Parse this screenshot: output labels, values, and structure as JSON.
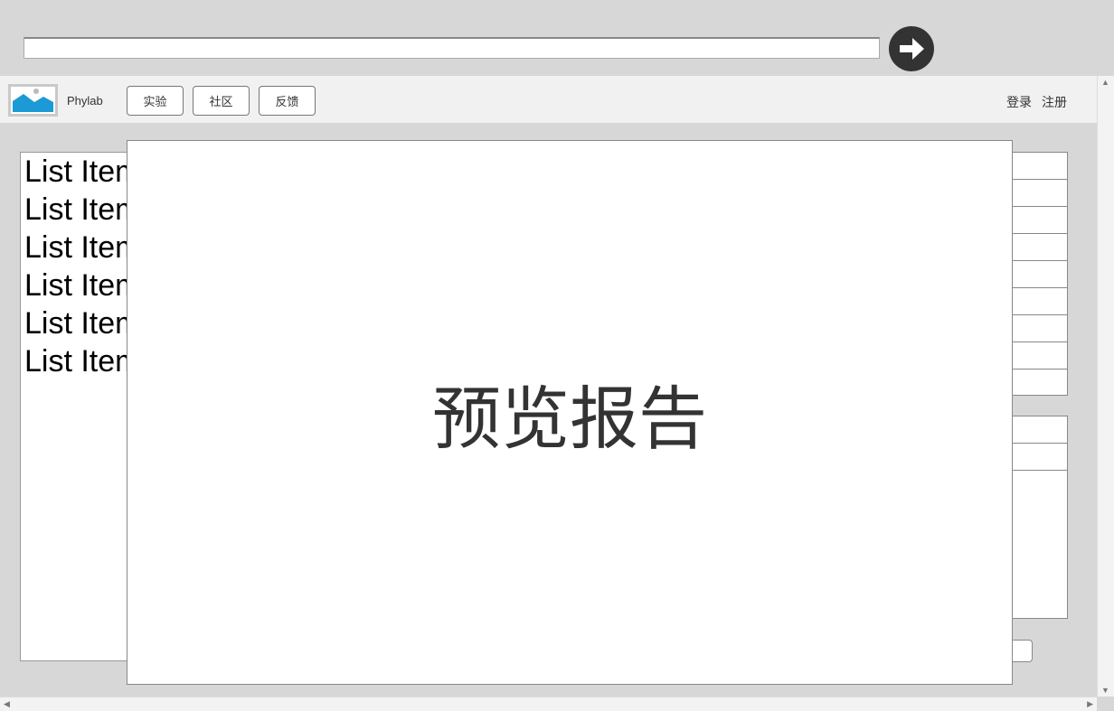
{
  "address_bar": {
    "value": ""
  },
  "go_button": {
    "icon": "arrow-right-icon"
  },
  "nav": {
    "brand": "Phylab",
    "buttons": [
      "实验",
      "社区",
      "反馈"
    ],
    "login": "登录",
    "register": "注册"
  },
  "list": {
    "items": [
      "List Item",
      "List Item",
      "List Item",
      "List Item",
      "List Item",
      "List Item"
    ]
  },
  "modal": {
    "title": "预览报告"
  }
}
